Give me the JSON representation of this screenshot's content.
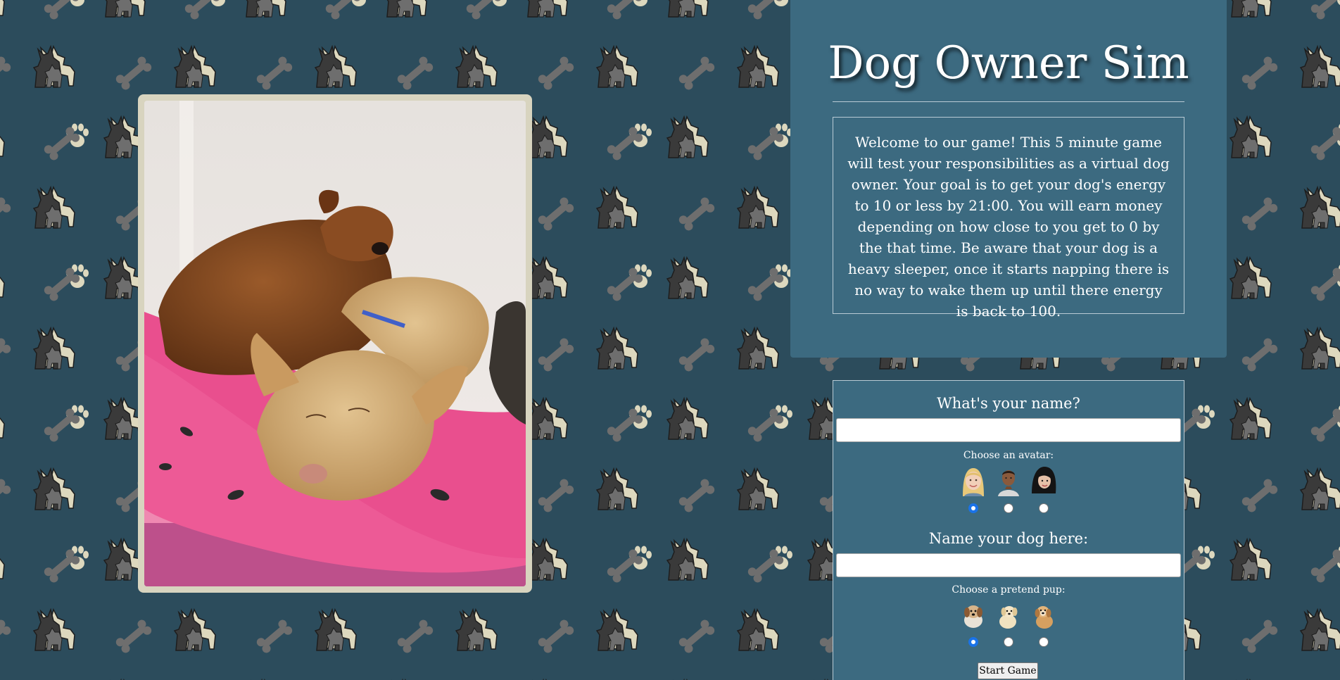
{
  "app": {
    "title": "Dog Owner Sim",
    "intro_text": "Welcome to our game! This 5 minute game will test your responsibilities as a virtual dog owner. Your goal is to get your dog's energy to 10 or less by 21:00. You will earn money depending on how close to you get to 0 by the that time. Be aware that your dog is a heavy sleeper, once it starts napping there is no way to wake them up until there energy is back to 100."
  },
  "form": {
    "name_label": "What's your name?",
    "name_value": "",
    "avatar_label": "Choose an avatar:",
    "avatars": [
      {
        "name": "avatar-blonde-woman",
        "selected": true
      },
      {
        "name": "avatar-man",
        "selected": false
      },
      {
        "name": "avatar-dark-hair-woman",
        "selected": false
      }
    ],
    "dog_name_label": "Name your dog here:",
    "dog_name_value": "",
    "pup_label": "Choose a pretend pup:",
    "pups": [
      {
        "name": "pup-pekingese",
        "selected": true
      },
      {
        "name": "pup-golden-puppy",
        "selected": false
      },
      {
        "name": "pup-tan-puppy",
        "selected": false
      }
    ],
    "start_label": "Start Game"
  },
  "colors": {
    "background": "#2c4c5c",
    "panel": "#3c6a80",
    "frame": "#d8d4bf",
    "pattern_cream": "#ddd8be",
    "pattern_grey": "#6e6e6e",
    "pattern_dark": "#3a3a3a"
  },
  "icons": {
    "pattern": [
      "dog-silhouette-icon",
      "bone-icon",
      "paw-print-icon"
    ],
    "photo": "sleeping-dogs-photo"
  }
}
